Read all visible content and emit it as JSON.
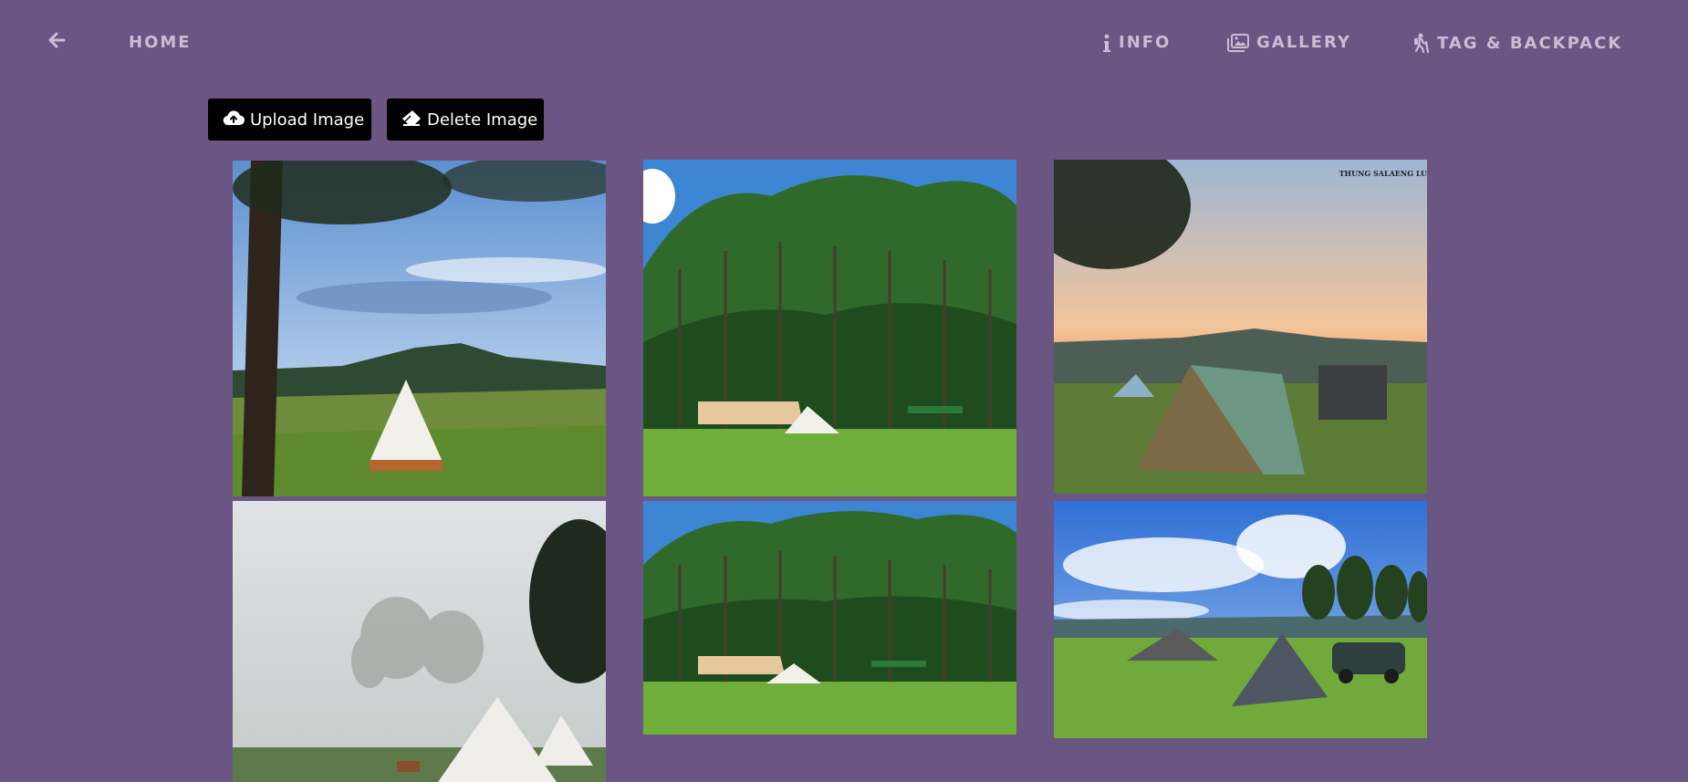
{
  "nav": {
    "back_icon": "arrow-left-icon",
    "home_label": "HOME",
    "info_label": "INFO",
    "info_icon": "info-icon",
    "gallery_label": "GALLERY",
    "gallery_icon": "images-icon",
    "tag_label": "TAG & BACKPACK",
    "tag_icon": "hiker-icon"
  },
  "actions": {
    "upload_label": "Upload Image",
    "upload_icon": "cloud-upload-icon",
    "delete_label": "Delete Image",
    "delete_icon": "eraser-icon"
  },
  "gallery": {
    "photos": [
      {
        "subject": "bell tent under pine trees with mountain view"
      },
      {
        "subject": "camp tents and canopy in pine forest"
      },
      {
        "subject": "dome tents at sunset",
        "watermark": "THUNG SALAENG LU"
      },
      {
        "subject": "bell tents in morning fog"
      },
      {
        "subject": "camp tents and canopy in pine forest"
      },
      {
        "subject": "tarp and pyramid tent beside car under blue sky"
      }
    ]
  },
  "colors": {
    "background": "#6b5582",
    "nav_text": "#c9bdd6",
    "button_bg": "#000000",
    "button_text": "#ffffff"
  }
}
